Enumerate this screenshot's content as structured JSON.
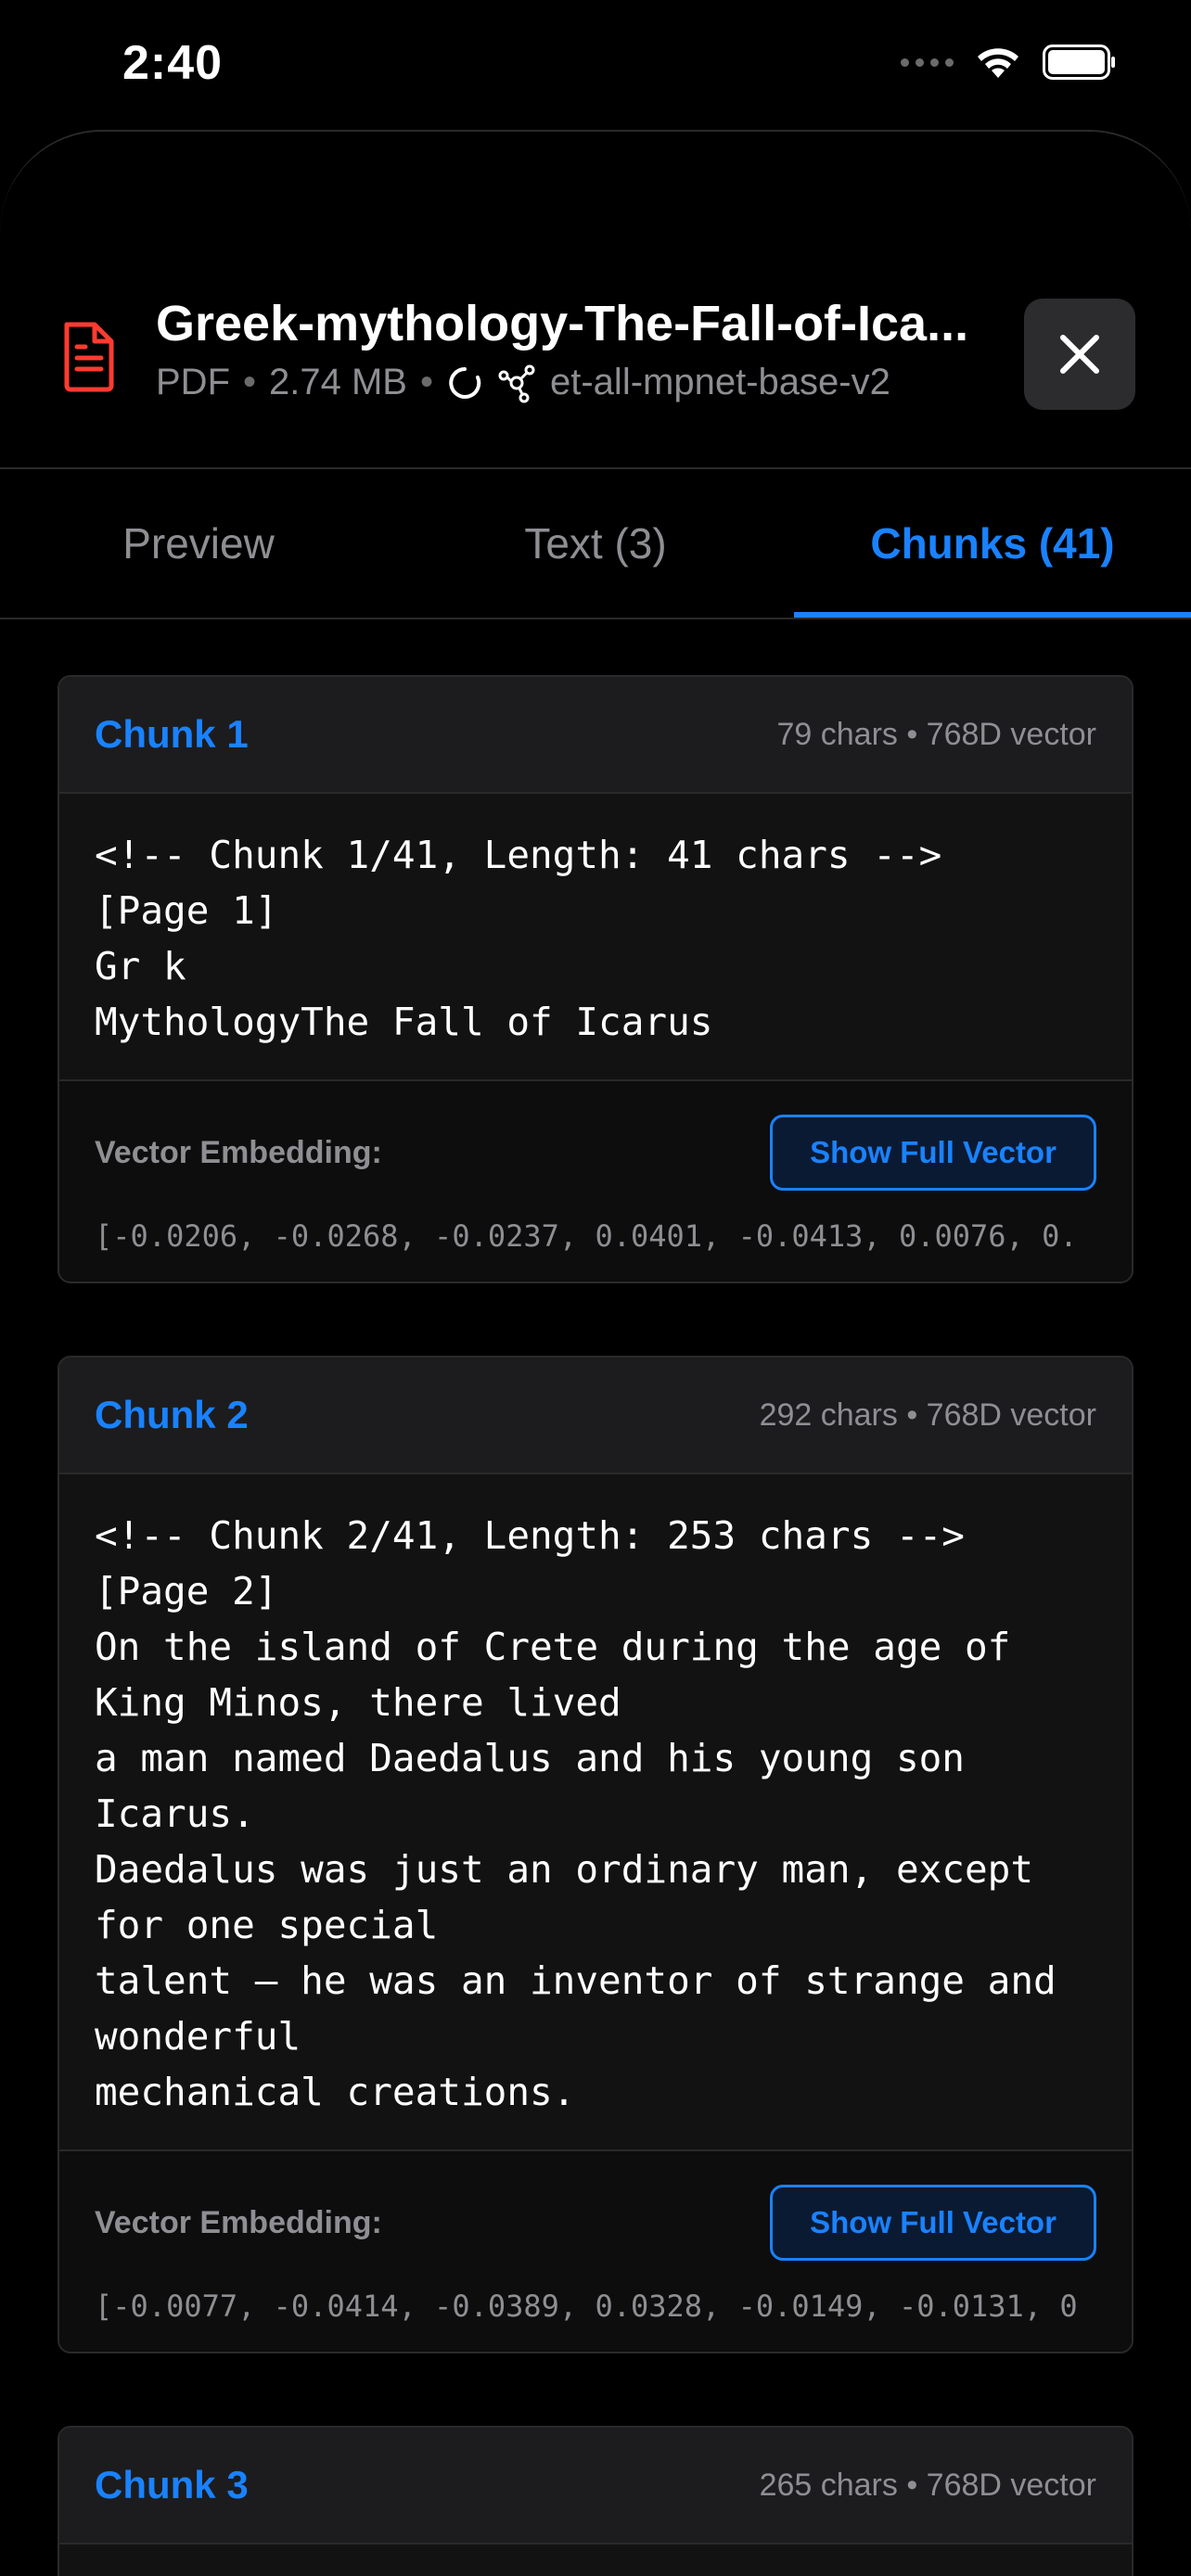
{
  "status_bar": {
    "time": "2:40"
  },
  "file": {
    "name": "Greek-mythology-The-Fall-of-Ica...",
    "type": "PDF",
    "size": "2.74 MB",
    "model": "et-all-mpnet-base-v2",
    "separator": "•"
  },
  "tabs": [
    {
      "label": "Preview",
      "active": false
    },
    {
      "label": "Text (3)",
      "active": false
    },
    {
      "label": "Chunks (41)",
      "active": true
    }
  ],
  "vector_label": "Vector Embedding:",
  "show_vector_label": "Show Full Vector",
  "chunks": [
    {
      "title": "Chunk 1",
      "info": "79 chars • 768D vector",
      "text": "<!-- Chunk 1/41, Length: 41 chars -->\n[Page 1]\nGr k\nMythologyThe Fall of Icarus",
      "vector": "[-0.0206, -0.0268, -0.0237, 0.0401, -0.0413, 0.0076, 0."
    },
    {
      "title": "Chunk 2",
      "info": "292 chars • 768D vector",
      "text": "<!-- Chunk 2/41, Length: 253 chars -->\n[Page 2]\nOn the island of Crete during the age of\nKing Minos, there lived\na man named Daedalus and his young son\nIcarus.\nDaedalus was just an ordinary man, except\nfor one special\ntalent – he was an inventor of strange and\nwonderful\nmechanical creations.",
      "vector": "[-0.0077, -0.0414, -0.0389, 0.0328, -0.0149, -0.0131, 0"
    },
    {
      "title": "Chunk 3",
      "info": "265 chars • 768D vector"
    }
  ],
  "colors": {
    "accent": "#1a82ff",
    "pdf_icon": "#ff3b30",
    "background": "#000000"
  }
}
